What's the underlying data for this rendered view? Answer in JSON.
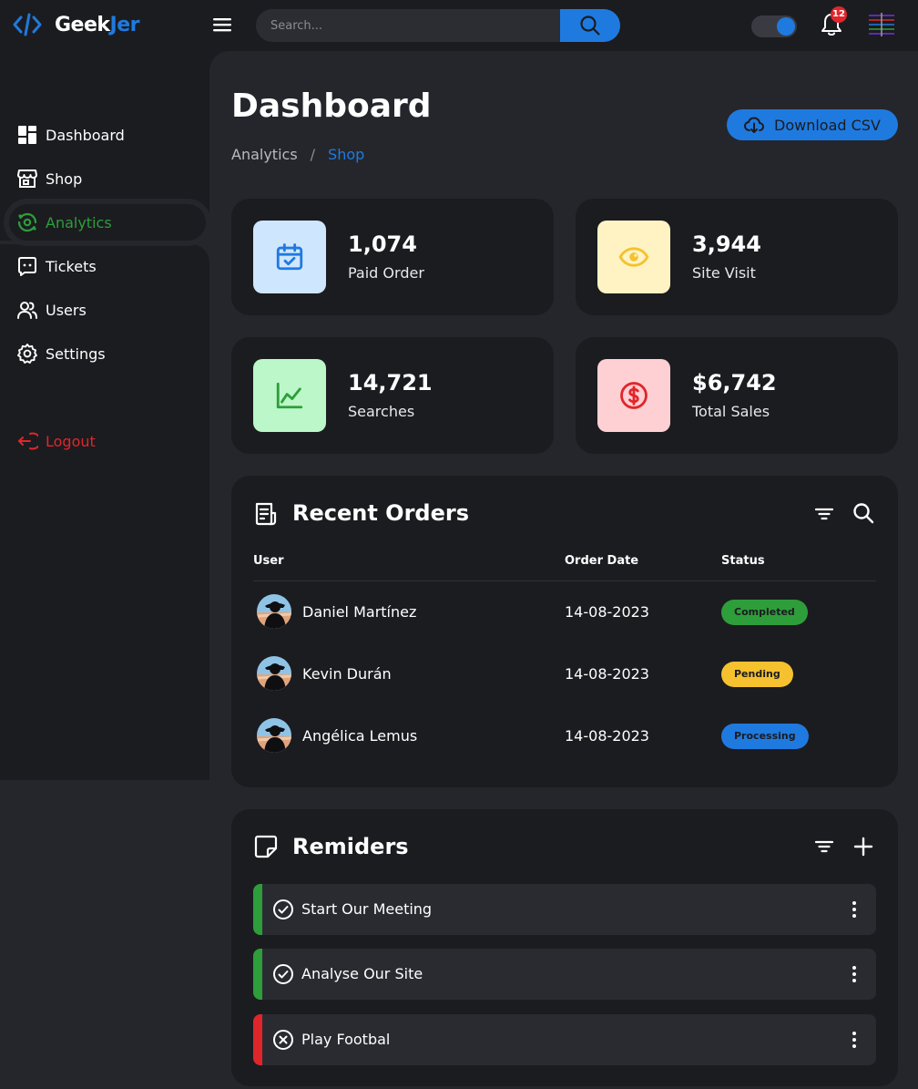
{
  "brand": {
    "part1": "Geek",
    "part2": "Jer"
  },
  "search": {
    "placeholder": "Search..."
  },
  "notifications": {
    "count": "12"
  },
  "sidebar": {
    "items": [
      {
        "label": "Dashboard",
        "icon": "dashboard-icon"
      },
      {
        "label": "Shop",
        "icon": "shop-icon"
      },
      {
        "label": "Analytics",
        "icon": "analytics-icon",
        "active": true
      },
      {
        "label": "Tickets",
        "icon": "tickets-icon"
      },
      {
        "label": "Users",
        "icon": "users-icon"
      },
      {
        "label": "Settings",
        "icon": "gear-icon"
      }
    ],
    "logout": "Logout"
  },
  "header": {
    "title": "Dashboard",
    "breadcrumb": [
      "Analytics",
      "/",
      "Shop"
    ],
    "download_label": "Download CSV"
  },
  "stats": [
    {
      "value": "1,074",
      "label": "Paid Order",
      "icon": "calendar-check-icon",
      "bg": "#cfe6ff",
      "fg": "#1f7ae0"
    },
    {
      "value": "3,944",
      "label": "Site Visit",
      "icon": "eye-icon",
      "bg": "#fff3c4",
      "fg": "#f5c12e"
    },
    {
      "value": "14,721",
      "label": "Searches",
      "icon": "line-chart-icon",
      "bg": "#bbf7c8",
      "fg": "#2e9e3a"
    },
    {
      "value": "$6,742",
      "label": "Total Sales",
      "icon": "dollar-icon",
      "bg": "#ffd0d3",
      "fg": "#e0262b"
    }
  ],
  "orders": {
    "title": "Recent Orders",
    "columns": [
      "User",
      "Order Date",
      "Status"
    ],
    "rows": [
      {
        "user": "Daniel Martínez",
        "date": "14-08-2023",
        "status": "Completed",
        "status_color": "#2e9e3a"
      },
      {
        "user": "Kevin Durán",
        "date": "14-08-2023",
        "status": "Pending",
        "status_color": "#f5c12e"
      },
      {
        "user": "Angélica Lemus",
        "date": "14-08-2023",
        "status": "Processing",
        "status_color": "#1f7ae0"
      }
    ]
  },
  "reminders": {
    "title": "Remiders",
    "items": [
      {
        "text": "Start Our Meeting",
        "done": true,
        "color": "#2e9e3a"
      },
      {
        "text": "Analyse Our Site",
        "done": true,
        "color": "#2e9e3a"
      },
      {
        "text": "Play Footbal",
        "done": false,
        "color": "#e0262b"
      }
    ]
  },
  "colors": {
    "accent": "#1f7ae0",
    "success": "#2e9e3a",
    "danger": "#e0262b",
    "warning": "#f5c12e",
    "panel": "#1b1c20",
    "background": "#25262b"
  }
}
